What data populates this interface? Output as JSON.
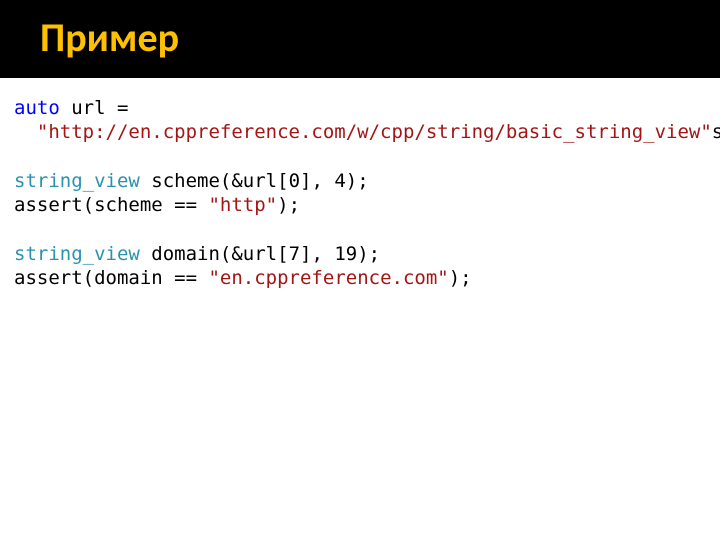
{
  "title": "Пример",
  "code": {
    "l1": {
      "kw": "auto",
      "rest": " url ="
    },
    "l2": {
      "indent": "  ",
      "str": "\"http://en.cppreference.com/w/cpp/string/basic_string_view\"",
      "suffix": "s;"
    },
    "l3": "",
    "l4": {
      "type": "string_view",
      "mid1": " scheme(&url[",
      "n": "0",
      "mid2": "], ",
      "n2": "4",
      "end": ");"
    },
    "l5": {
      "fn": "assert",
      "open": "(scheme == ",
      "str": "\"http\"",
      "close": ");"
    },
    "l6": "",
    "l7": {
      "type": "string_view",
      "mid1": " domain(&url[",
      "n": "7",
      "mid2": "], ",
      "n2": "19",
      "end": ");"
    },
    "l8": {
      "fn": "assert",
      "open": "(domain == ",
      "str": "\"en.cppreference.com\"",
      "close": ");"
    }
  }
}
